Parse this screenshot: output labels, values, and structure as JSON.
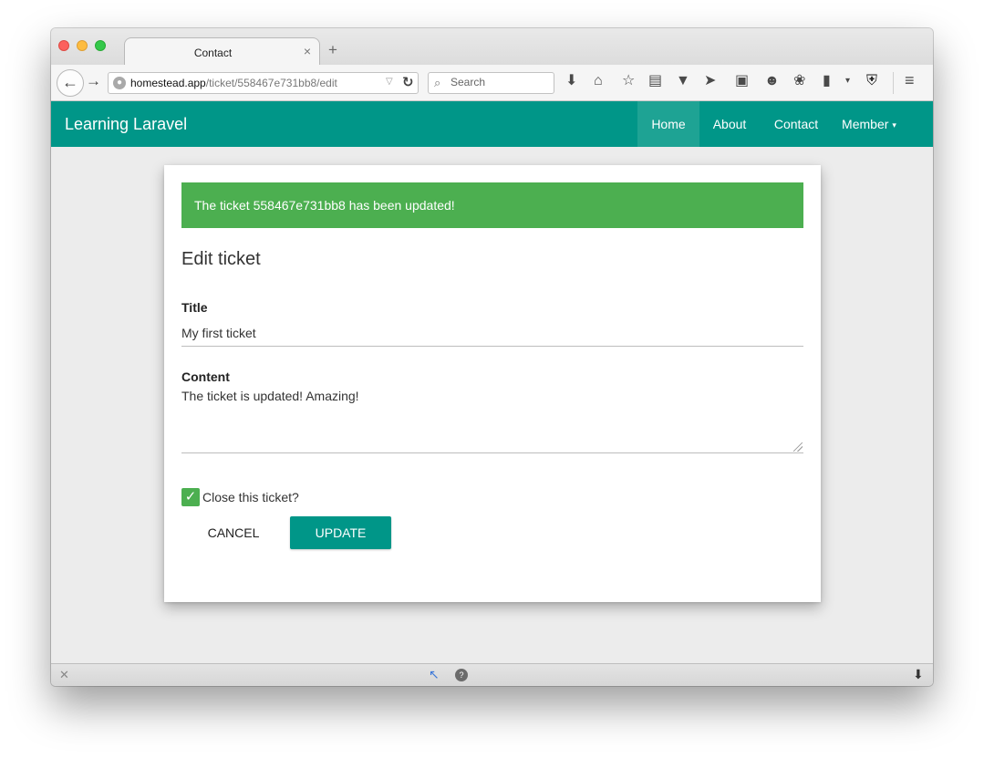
{
  "browser": {
    "tab_title": "Contact",
    "tab_close": "×",
    "new_tab": "+",
    "url_host": "homestead.app",
    "url_path": "/ticket/558467e731bb8/edit",
    "search_placeholder": "Search"
  },
  "navbar": {
    "brand": "Learning Laravel",
    "items": [
      {
        "label": "Home",
        "active": true
      },
      {
        "label": "About"
      },
      {
        "label": "Contact"
      },
      {
        "label": "Member",
        "caret": "▾"
      }
    ],
    "color": "#009688"
  },
  "alert": {
    "message": "The ticket 558467e731bb8 has been updated!",
    "color": "#4caf50"
  },
  "form": {
    "heading": "Edit ticket",
    "title_label": "Title",
    "title_value": "My first ticket",
    "content_label": "Content",
    "content_value": "The ticket is updated! Amazing!",
    "checkbox_label": "Close this ticket?",
    "checkbox_checked": true,
    "cancel_label": "CANCEL",
    "update_label": "UPDATE"
  }
}
